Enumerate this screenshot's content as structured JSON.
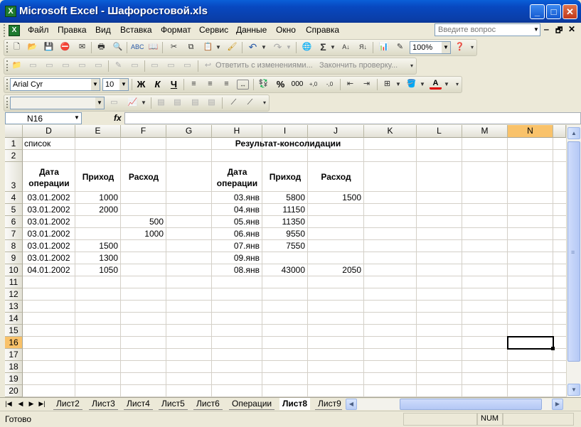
{
  "window": {
    "title": "Microsoft Excel - Шафоростовой.xls",
    "minimize": "_",
    "maximize": "□",
    "close": "✕"
  },
  "menu": {
    "items": [
      "Файл",
      "Правка",
      "Вид",
      "Вставка",
      "Формат",
      "Сервис",
      "Данные",
      "Окно",
      "Справка"
    ],
    "help_placeholder": "Введите вопрос",
    "doc_controls": [
      "‒",
      "🗗",
      "✕"
    ]
  },
  "toolbar_standard": {
    "zoom": "100%"
  },
  "toolbar_review": {
    "reply_label": "Ответить с изменениями...",
    "end_review_label": "Закончить проверку..."
  },
  "toolbar_format": {
    "font": "Arial Cyr",
    "size": "10",
    "bold": "Ж",
    "italic": "К",
    "underline": "Ч",
    "percent": "%",
    "thousands": "000"
  },
  "formula_bar": {
    "name_box": "N16",
    "fx": "fx",
    "formula": ""
  },
  "columns": [
    "D",
    "E",
    "F",
    "G",
    "H",
    "I",
    "J",
    "K",
    "L",
    "M",
    "N"
  ],
  "rows": [
    "1",
    "2",
    "3",
    "4",
    "5",
    "6",
    "7",
    "8",
    "9",
    "10",
    "11",
    "12",
    "13",
    "14",
    "15",
    "16",
    "17",
    "18",
    "19",
    "20"
  ],
  "cells": {
    "D1": "список",
    "H1": "Результат-консолидации",
    "D3": "Дата операции",
    "E3": "Приход",
    "F3": "Расход",
    "H3": "Дата операции",
    "I3": "Приход",
    "J3": "Расход"
  },
  "left_table": [
    {
      "date": "03.01.2002",
      "in": "1000",
      "out": ""
    },
    {
      "date": "03.01.2002",
      "in": "2000",
      "out": ""
    },
    {
      "date": "03.01.2002",
      "in": "",
      "out": "500"
    },
    {
      "date": "03.01.2002",
      "in": "",
      "out": "1000"
    },
    {
      "date": "03.01.2002",
      "in": "1500",
      "out": ""
    },
    {
      "date": "03.01.2002",
      "in": "1300",
      "out": ""
    },
    {
      "date": "04.01.2002",
      "in": "1050",
      "out": ""
    }
  ],
  "right_table": [
    {
      "date": "03.янв",
      "in": "5800",
      "out": "1500"
    },
    {
      "date": "04.янв",
      "in": "11150",
      "out": ""
    },
    {
      "date": "05.янв",
      "in": "11350",
      "out": ""
    },
    {
      "date": "06.янв",
      "in": "9550",
      "out": ""
    },
    {
      "date": "07.янв",
      "in": "7550",
      "out": ""
    },
    {
      "date": "09.янв",
      "in": "",
      "out": ""
    },
    {
      "date": "08.янв",
      "in": "43000",
      "out": "2050"
    }
  ],
  "tabs": [
    "Лист2",
    "Лист3",
    "Лист4",
    "Лист5",
    "Лист6",
    "Операции",
    "Лист8",
    "Лист9"
  ],
  "active_tab": "Лист8",
  "status": {
    "text": "Готово",
    "num": "NUM"
  },
  "colors": {
    "title_bar": "#0a4ec8",
    "selected_header": "#f9c26a",
    "window_bg": "#ece9d8"
  }
}
